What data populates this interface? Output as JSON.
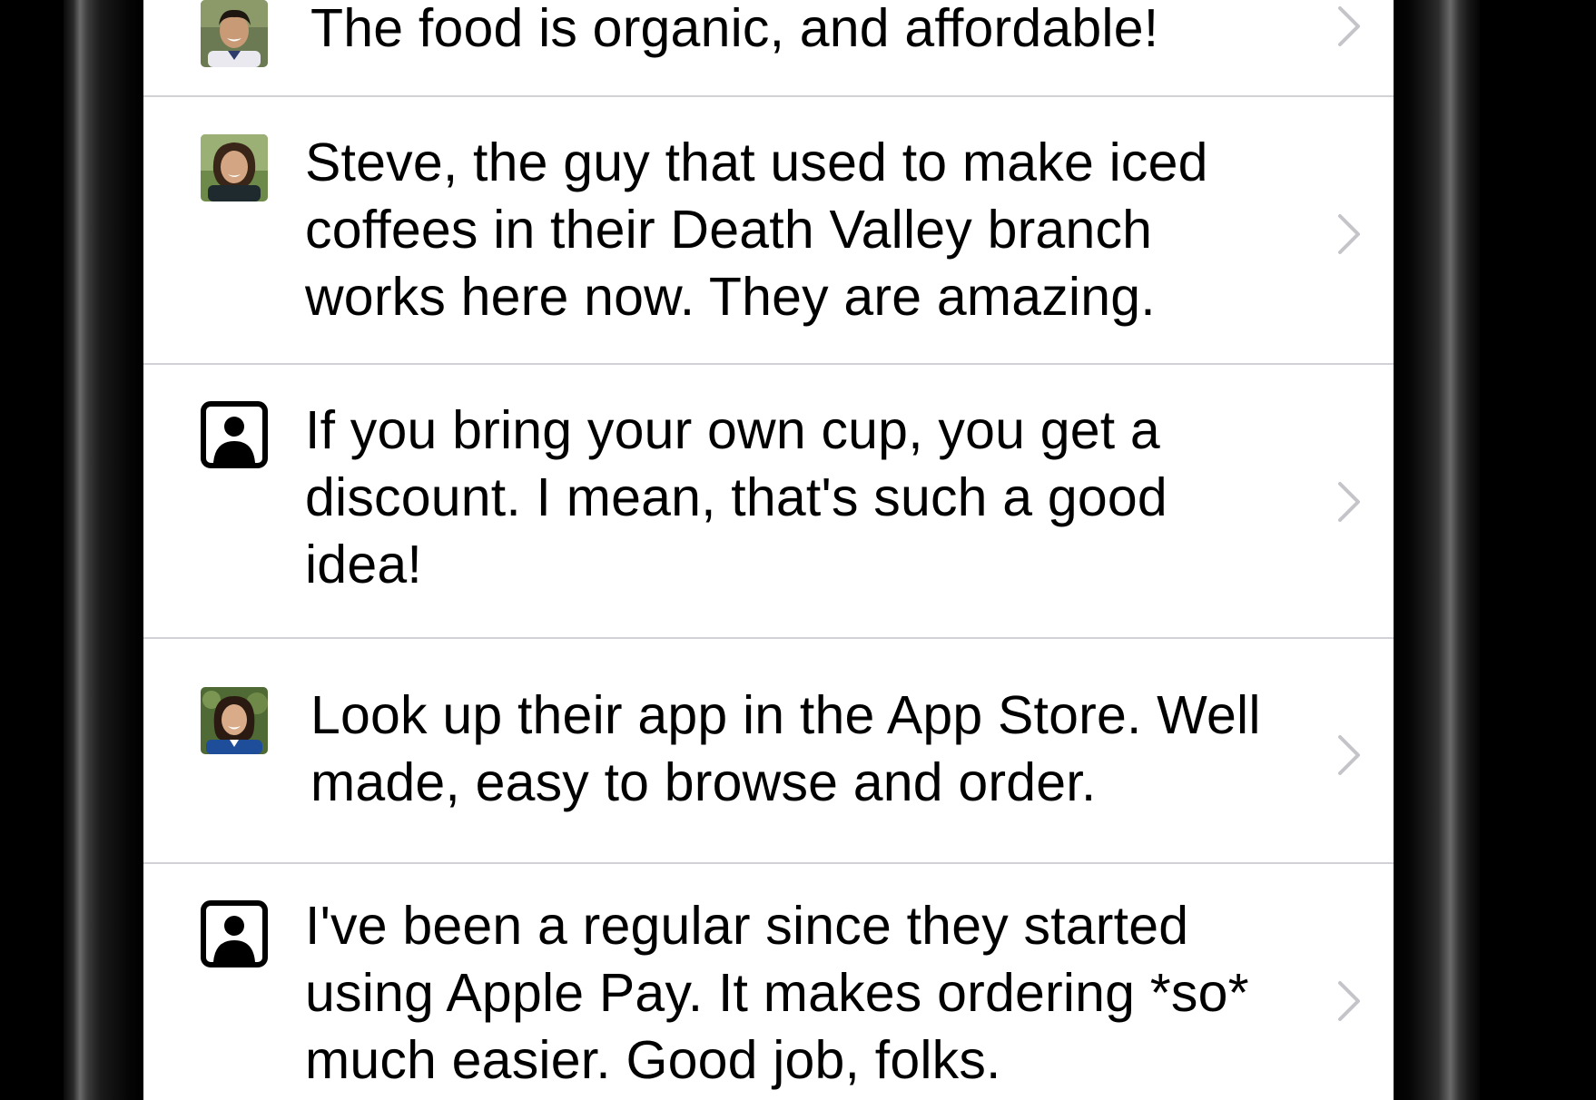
{
  "reviews": [
    {
      "avatar": "photo",
      "avatar_icon": "avatar-photo-man",
      "text": "The food is organic, and affordable!"
    },
    {
      "avatar": "photo",
      "avatar_icon": "avatar-photo-woman-1",
      "text": "Steve, the guy that used to make iced coffees in their Death Valley branch works here now. They are amazing."
    },
    {
      "avatar": "placeholder",
      "avatar_icon": "person-placeholder-icon",
      "text": "If you bring your own cup, you get a discount. I mean, that's such a good idea!"
    },
    {
      "avatar": "photo",
      "avatar_icon": "avatar-photo-woman-2",
      "text": "Look up their app in the App Store. Well made, easy to browse and order."
    },
    {
      "avatar": "placeholder",
      "avatar_icon": "person-placeholder-icon",
      "text": "I've been a regular since they started using Apple Pay. It makes ordering *so* much easier. Good job, folks."
    }
  ],
  "colors": {
    "separator": "#d1d1d6",
    "chevron": "#c4c4c9",
    "text": "#000000",
    "background": "#ffffff"
  }
}
